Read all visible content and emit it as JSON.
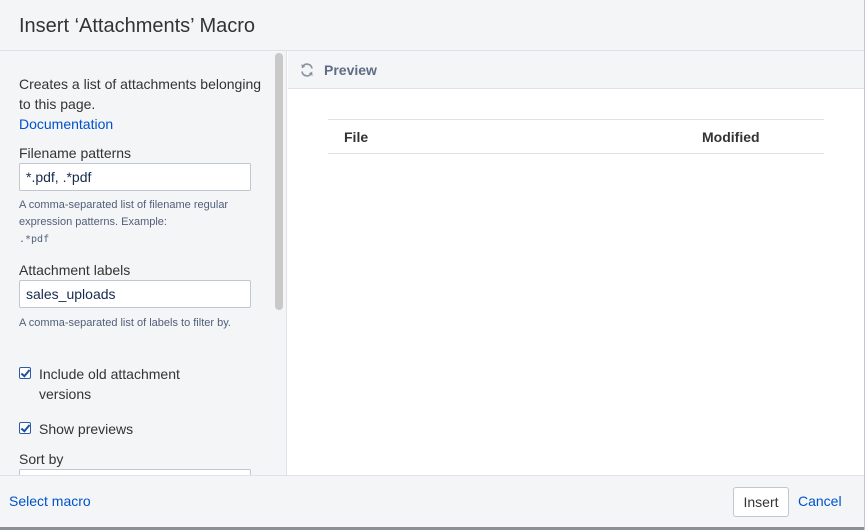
{
  "dialog": {
    "title": "Insert ‘Attachments’ Macro"
  },
  "left_panel": {
    "description": "Creates a list of attachments belonging to this page.",
    "documentation_link": "Documentation",
    "filename_patterns": {
      "label": "Filename patterns",
      "value": "*.pdf, .*pdf",
      "help": "A comma-separated list of filename regular expression patterns. Example:",
      "example": ".*pdf"
    },
    "attachment_labels": {
      "label": "Attachment labels",
      "value": "sales_uploads",
      "help": "A comma-separated list of labels to filter by."
    },
    "include_old_versions": {
      "label": "Include old attachment versions",
      "checked": true
    },
    "show_previews": {
      "label": "Show previews",
      "checked": true
    },
    "sort_by": {
      "label": "Sort by"
    }
  },
  "preview": {
    "icon": "refresh-icon",
    "label": "Preview",
    "table_headers": [
      "File",
      "Modified"
    ]
  },
  "footer": {
    "select_macro": "Select macro",
    "insert": "Insert",
    "cancel": "Cancel"
  },
  "colors": {
    "link": "#0052cc",
    "panel_bg": "#f4f5f7",
    "checkbox": "#1f4fa0"
  }
}
